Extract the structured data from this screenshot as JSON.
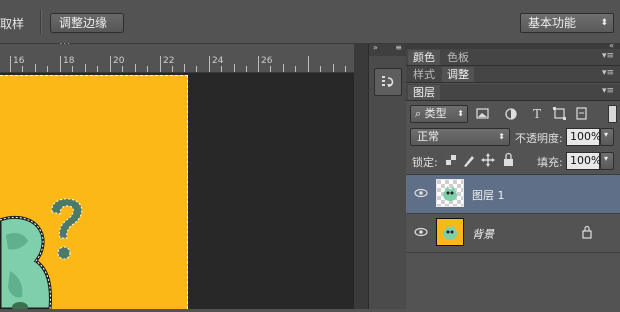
{
  "toolbar": {
    "sample_label": "取样",
    "refine_edge_label": "调整边缘 ...",
    "workspace_label": "基本功能"
  },
  "ruler": {
    "labels": [
      "16",
      "18",
      "20",
      "22",
      "24",
      "26"
    ]
  },
  "panels": {
    "color_tabs": [
      "颜色",
      "色板"
    ],
    "adjust_tabs": [
      "样式",
      "调整"
    ],
    "layers_tab": "图层",
    "filter_kind": "类型",
    "blend_mode": "正常",
    "opacity_label": "不透明度:",
    "opacity_value": "100%",
    "lock_label": "锁定:",
    "fill_label": "填充:",
    "fill_value": "100%"
  },
  "layers": [
    {
      "name": "图层 1",
      "selected": true
    },
    {
      "name": "背景",
      "locked": true
    }
  ],
  "colors": {
    "canvas": "#fbb816",
    "selected_layer": "#5f6f88"
  }
}
